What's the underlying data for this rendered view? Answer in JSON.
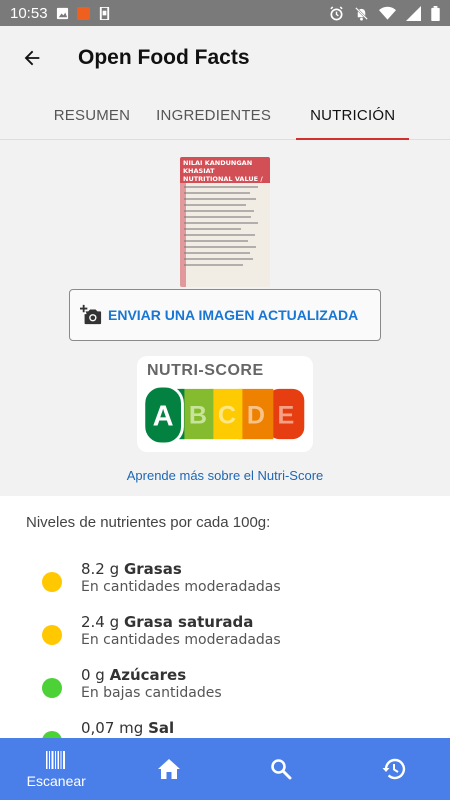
{
  "status_bar": {
    "time": "10:53",
    "icons": [
      "image-icon",
      "app-icon",
      "phone-icon",
      "alarm-icon",
      "mute-icon",
      "wifi-icon",
      "signal-icon",
      "battery-icon"
    ]
  },
  "app_bar": {
    "title": "Open Food Facts",
    "back_icon": "arrow-back-icon"
  },
  "tabs": [
    {
      "label": "RESUMEN",
      "active": false
    },
    {
      "label": "INGREDIENTES",
      "active": false
    },
    {
      "label": "NUTRICIÓN",
      "active": true
    }
  ],
  "product_image": {
    "label_line1": "NILAI KANDUNGAN KHASIAT",
    "label_line2": "NUTRITIONAL VALUE / 营养成份"
  },
  "upload_button": {
    "label": "ENVIAR UNA IMAGEN ACTUALIZADA",
    "icon": "add-photo-icon"
  },
  "nutri_score": {
    "title": "NUTRI-SCORE",
    "grades": [
      {
        "letter": "A",
        "color": "#038141"
      },
      {
        "letter": "B",
        "color": "#85bb2f"
      },
      {
        "letter": "C",
        "color": "#fecb02"
      },
      {
        "letter": "D",
        "color": "#ee8100"
      },
      {
        "letter": "E",
        "color": "#e63e11"
      }
    ],
    "selected": "A"
  },
  "learn_more_link": "Aprende más sobre el Nutri-Score",
  "nutrient_levels": {
    "title": "Niveles de nutrientes por cada 100g:",
    "items": [
      {
        "amount": "8.2 g",
        "name": "Grasas",
        "level": "En cantidades moderadadas",
        "color": "#ffc800"
      },
      {
        "amount": "2.4 g",
        "name": "Grasa saturada",
        "level": "En cantidades moderadadas",
        "color": "#ffc800"
      },
      {
        "amount": "0 g",
        "name": "Azúcares",
        "level": "En bajas cantidades",
        "color": "#4cd137"
      },
      {
        "amount": "0,07 mg",
        "name": "Sal",
        "level": "",
        "color": "#4cd137"
      }
    ]
  },
  "bottom_nav": {
    "scan_label": "Escanear",
    "items": [
      "barcode-icon",
      "home-icon",
      "search-icon",
      "history-icon"
    ]
  }
}
